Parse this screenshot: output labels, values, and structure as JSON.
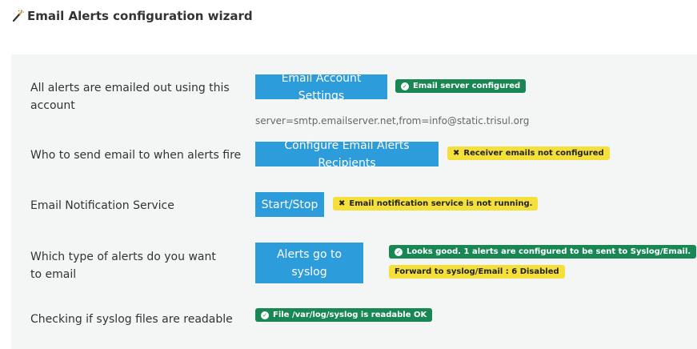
{
  "header": {
    "title": "Email Alerts configuration wizard",
    "icon": "magic-wand-icon"
  },
  "rows": [
    {
      "label": "All alerts are emailed out using this account",
      "button": "Email Account Settings",
      "badges": [
        {
          "text": "Email server configured",
          "status": "success",
          "icon": "check-circle-icon"
        }
      ],
      "subtext": "server=smtp.emailserver.net,from=info@static.trisul.org"
    },
    {
      "label": "Who to send email to when alerts fire",
      "button": "Configure Email Alerts Recipients",
      "badges": [
        {
          "text": "Receiver emails not configured",
          "status": "warning",
          "icon": "x-icon"
        }
      ]
    },
    {
      "label": "Email Notification Service",
      "button": "Start/Stop",
      "badges": [
        {
          "text": "Email notification service is not running.",
          "status": "warning",
          "icon": "x-icon"
        }
      ]
    },
    {
      "label": "Which type of alerts do you want to email",
      "button": "Alerts go to syslog",
      "badges": [
        {
          "text": "Looks good. 1 alerts are configured to be sent to Syslog/Email.",
          "status": "success",
          "icon": "check-circle-icon"
        },
        {
          "text": "Forward to syslog/Email : 6 Disabled",
          "status": "warning"
        }
      ]
    },
    {
      "label": "Checking if syslog files are readable",
      "badges": [
        {
          "text": "File /var/log/syslog is readable OK",
          "status": "success",
          "icon": "check-circle-icon"
        }
      ]
    }
  ],
  "colors": {
    "button": "#2d9cdb",
    "success": "#198754",
    "warning": "#f4df3b",
    "panel": "#f4f5f5"
  }
}
